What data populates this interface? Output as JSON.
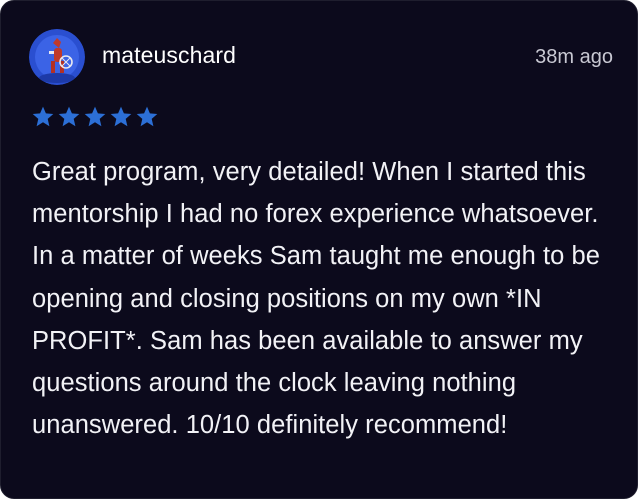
{
  "review": {
    "username": "mateuschard",
    "timestamp": "38m ago",
    "rating": 5,
    "rating_max": 5,
    "text": "Great program, very detailed! When I started this mentorship I had no forex experience whatsoever. In a matter of weeks Sam taught me enough to be opening and closing positions on my own *IN PROFIT*. Sam has been available to answer my questions around the clock leaving nothing unanswered. 10/10 definitely recommend!"
  },
  "icons": {
    "avatar": "avatar-illustration",
    "star": "star-icon"
  },
  "colors": {
    "card_background": "#0c0a1c",
    "star": "#2c6fd6",
    "text": "#f2f2f6",
    "timestamp": "#c8c8d2"
  }
}
